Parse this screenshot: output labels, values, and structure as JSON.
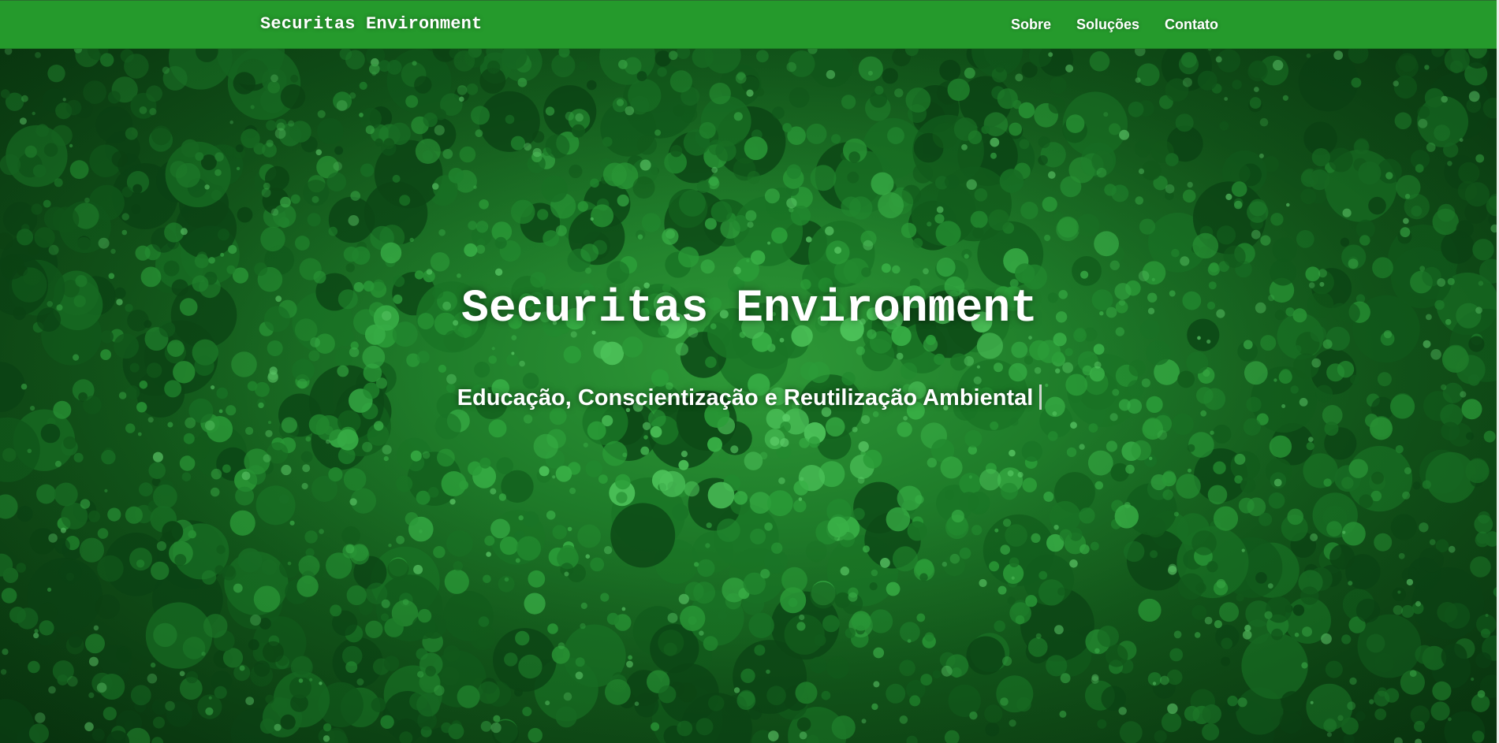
{
  "header": {
    "brand": "Securitas Environment",
    "nav": [
      {
        "label": "Sobre"
      },
      {
        "label": "Soluções"
      },
      {
        "label": "Contato"
      }
    ]
  },
  "hero": {
    "title": "Securitas Environment",
    "subtitle": "Educação, Conscientização e Reutilização Ambiental",
    "background_image": "forest-canopy-aerial"
  },
  "colors": {
    "navbar": "#259a2c",
    "text": "#ffffff",
    "forest_dark": "#0a3a10",
    "forest_light": "#3cb04a"
  }
}
